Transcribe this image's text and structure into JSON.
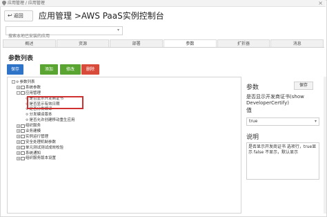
{
  "titlebar": {
    "path": "应用管理 / 应用管理",
    "close": "×"
  },
  "header": {
    "back_label": "返回",
    "title": "应用管理 >AWS PaaS实例控制台"
  },
  "search": {
    "placeholder": "搜索本地已安装的应用"
  },
  "tabs": [
    {
      "label": "概述",
      "active": false
    },
    {
      "label": "资源",
      "active": false
    },
    {
      "label": "部署",
      "active": false
    },
    {
      "label": "参数",
      "active": true
    },
    {
      "label": "扩折器",
      "active": false
    },
    {
      "label": "消息",
      "active": false
    }
  ],
  "section_title": "参数列表",
  "toolbar": {
    "save": "保存",
    "add": "添加",
    "edit": "修改",
    "delete": "删除"
  },
  "tree": [
    {
      "level": 0,
      "exp": "-",
      "kind": "gear",
      "label": "参数列表"
    },
    {
      "level": 1,
      "exp": "+",
      "kind": "folder",
      "label": "系统参数"
    },
    {
      "level": 1,
      "exp": "-",
      "kind": "folder",
      "label": "应用管理"
    },
    {
      "level": 2,
      "exp": "",
      "kind": "leaf",
      "label": "是否显示开发商证书"
    },
    {
      "level": 2,
      "exp": "",
      "kind": "leaf",
      "label": "是否显示有效日期"
    },
    {
      "level": 2,
      "exp": "",
      "kind": "leaf",
      "label": "是否分发编译"
    },
    {
      "level": 2,
      "exp": "",
      "kind": "leaf",
      "label": "分发编译版本"
    },
    {
      "level": 2,
      "exp": "",
      "kind": "leaf",
      "label": "是否允许创建移动重生应用"
    },
    {
      "level": 1,
      "exp": "+",
      "kind": "folder",
      "label": "组织服务"
    },
    {
      "level": 1,
      "exp": "+",
      "kind": "folder",
      "label": "业务建模"
    },
    {
      "level": 1,
      "exp": "+",
      "kind": "folder",
      "label": "实例运行管理"
    },
    {
      "level": 1,
      "exp": "+",
      "kind": "folder",
      "label": "安全处理机制参数"
    },
    {
      "level": 1,
      "exp": "+",
      "kind": "folder",
      "label": "单元测试测试成效校验"
    },
    {
      "level": 1,
      "exp": "+",
      "kind": "folder",
      "label": "系统通知"
    },
    {
      "level": 1,
      "exp": "+",
      "kind": "folder",
      "label": "组织服务版本设置"
    }
  ],
  "right": {
    "param_label": "参数",
    "save": "保存",
    "param_desc": "是否显示开发商证书(show DeveloperCertify)",
    "value_label": "值",
    "value": "true",
    "desc_label": "说明",
    "desc_text": "是否显示开发商证书 选项行，true显示 false 不显示，默认显示"
  }
}
